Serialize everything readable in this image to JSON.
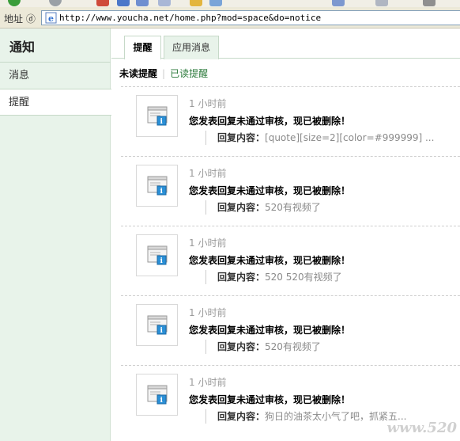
{
  "browser": {
    "address_label": "地址 ⓓ",
    "url": "http://www.youcha.net/home.php?mod=space&do=notice"
  },
  "sidebar": {
    "title": "通知",
    "items": [
      {
        "label": "消息",
        "active": false
      },
      {
        "label": "提醒",
        "active": true
      }
    ]
  },
  "tabs": [
    {
      "label": "提醒",
      "active": true
    },
    {
      "label": "应用消息",
      "active": false
    }
  ],
  "subnav": {
    "current": "未读提醒",
    "link": "已读提醒"
  },
  "notices": [
    {
      "time": "1 小时前",
      "message": "您发表回复未通过审核，现已被删除！",
      "quote_label": "回复内容：",
      "quote": "[quote][size=2][color=#999999] ..."
    },
    {
      "time": "1 小时前",
      "message": "您发表回复未通过审核，现已被删除！",
      "quote_label": "回复内容：",
      "quote": "520有视频了"
    },
    {
      "time": "1 小时前",
      "message": "您发表回复未通过审核，现已被删除！",
      "quote_label": "回复内容：",
      "quote": "520 520有视频了"
    },
    {
      "time": "1 小时前",
      "message": "您发表回复未通过审核，现已被删除！",
      "quote_label": "回复内容：",
      "quote": "520有视频了"
    },
    {
      "time": "1 小时前",
      "message": "您发表回复未通过审核，现已被删除！",
      "quote_label": "回复内容：",
      "quote": "狗日的油茶太小气了吧，抓紧五..."
    }
  ],
  "colors": {
    "sidebar_bg": "#e8f3ea",
    "link": "#2b7a3b",
    "time": "#999999"
  },
  "watermark": "www.520"
}
